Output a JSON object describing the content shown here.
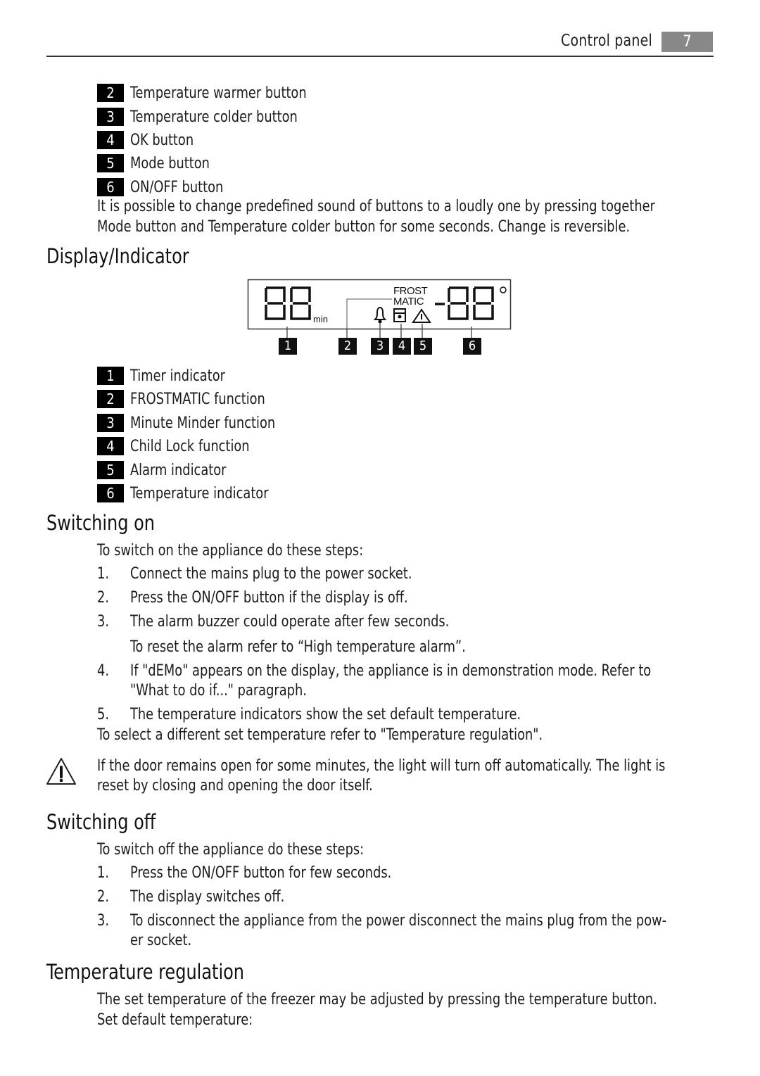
{
  "header": {
    "section_title": "Control panel",
    "page_number": "7"
  },
  "buttons_legend": [
    {
      "num": "2",
      "label": "Temperature warmer button"
    },
    {
      "num": "3",
      "label": "Temperature colder button"
    },
    {
      "num": "4",
      "label": "OK button"
    },
    {
      "num": "5",
      "label": "Mode button"
    },
    {
      "num": "6",
      "label": "ON/OFF button"
    }
  ],
  "sound_note": {
    "line1": "It is possible to change predefined sound of buttons to a loudly one by pressing together",
    "line2": "Mode button and Temperature colder button for some seconds. Change is reversible."
  },
  "display_section": {
    "heading": "Display/Indicator",
    "lcd": {
      "timer_digits": "88",
      "timer_unit": "min",
      "frost_label_1": "FROST",
      "frost_label_2": "MATIC",
      "temp_sign": "-",
      "temp_digits": "88",
      "degree_symbol": "°",
      "icons": [
        "bell-icon",
        "lock-icon",
        "warning-icon"
      ]
    },
    "callouts": [
      "1",
      "2",
      "3",
      "4",
      "5",
      "6"
    ],
    "legend": [
      {
        "num": "1",
        "label": "Timer indicator"
      },
      {
        "num": "2",
        "label": "FROSTMATIC function"
      },
      {
        "num": "3",
        "label": "Minute Minder function"
      },
      {
        "num": "4",
        "label": "Child Lock function"
      },
      {
        "num": "5",
        "label": "Alarm indicator"
      },
      {
        "num": "6",
        "label": "Temperature indicator"
      }
    ]
  },
  "switching_on": {
    "heading": "Switching on",
    "intro": "To switch on the appliance do these steps:",
    "steps": [
      {
        "num": "1.",
        "text": "Connect the mains plug to the power socket."
      },
      {
        "num": "2.",
        "text": "Press the ON/OFF button if the display is off."
      },
      {
        "num": "3.",
        "text": "The alarm buzzer could operate after few seconds."
      },
      {
        "num": "",
        "text": "To reset the alarm refer to “High temperature alarm”."
      },
      {
        "num": "4.",
        "text": "If \"dEMo\" appears on the display, the appliance is in demonstration mode. Refer to"
      },
      {
        "num": "",
        "text": "\"What to do if...\" paragraph."
      },
      {
        "num": "5.",
        "text": "The temperature indicators show the set default temperature."
      }
    ],
    "outro": "To select a different set temperature refer to \"Temperature regulation\".",
    "warning": {
      "icon": "warning-icon",
      "line1": "If the door remains open for some minutes, the light will turn off automatically. The light is",
      "line2": "reset by closing and opening the door itself."
    }
  },
  "switching_off": {
    "heading": "Switching off",
    "intro": "To switch off the appliance do these steps:",
    "steps": [
      {
        "num": "1.",
        "text": "Press the ON/OFF button for few seconds."
      },
      {
        "num": "2.",
        "text": "The display switches off."
      },
      {
        "num": "3.",
        "text": "To disconnect the appliance from the power disconnect the mains plug from the pow-"
      },
      {
        "num": "",
        "text": "er socket."
      }
    ]
  },
  "temperature_regulation": {
    "heading": "Temperature regulation",
    "line1": "The set temperature of the freezer may be adjusted by pressing the temperature button.",
    "line2": "Set default temperature:"
  }
}
